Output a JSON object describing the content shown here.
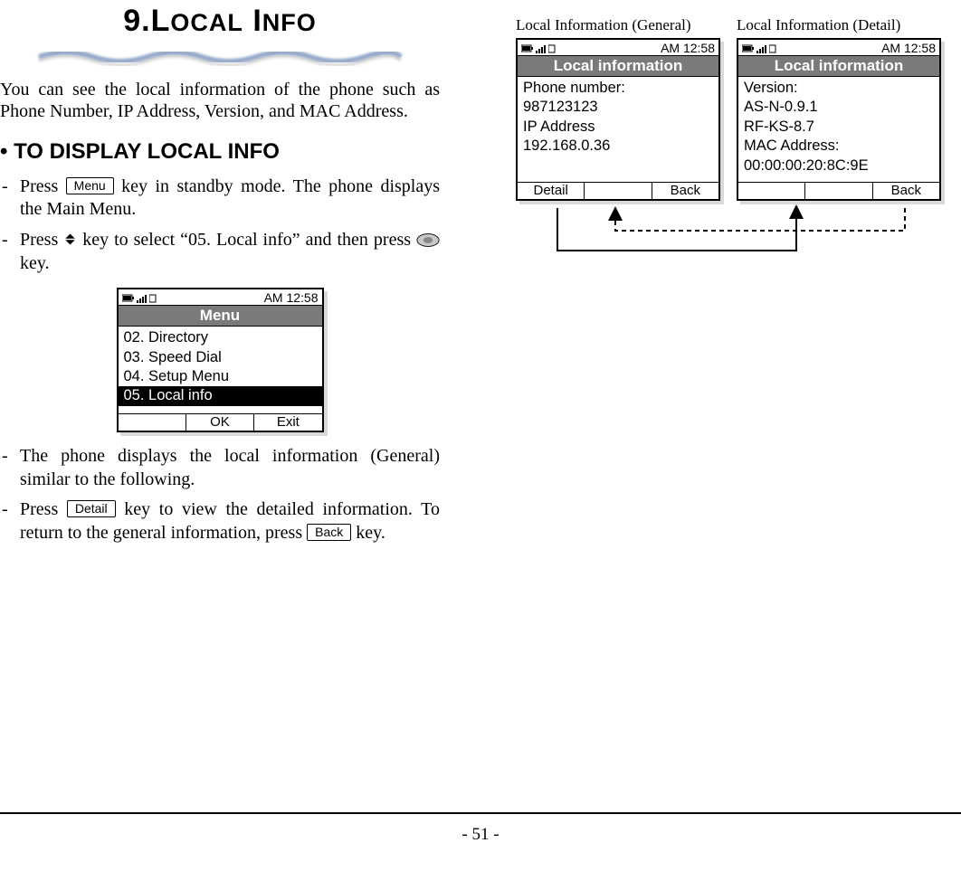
{
  "chapter": {
    "number": "9.",
    "title_word1": "L",
    "title_rest1": "OCAL",
    "title_word2": "I",
    "title_rest2": "NFO"
  },
  "intro": "You can see the local information of the phone such as Phone Number, IP Address, Version, and MAC Address.",
  "section_heading": "• TO DISPLAY LOCAL INFO",
  "steps": {
    "s1a": "Press ",
    "s1b": " key in standby mode. The phone displays the Main Menu.",
    "s2a": "Press ",
    "s2b": " key to select “05. Local info” and then press ",
    "s2c": " key.",
    "s3": "The phone displays the local information (General) similar to the following.",
    "s4a": "Press ",
    "s4b": " key to view the detailed information. To return to the general information, press ",
    "s4c": " key."
  },
  "buttons": {
    "menu": "Menu",
    "detail": "Detail",
    "back": "Back"
  },
  "menu_phone": {
    "time": "AM 12:58",
    "title": "Menu",
    "items": [
      "02. Directory",
      "03. Speed Dial",
      "04. Setup Menu",
      "05. Local info"
    ],
    "selected_index": 3,
    "soft": {
      "left": "",
      "center": "OK",
      "right": "Exit"
    }
  },
  "captions": {
    "general": "Local Information (General)",
    "detail": "Local Information (Detail)"
  },
  "general_phone": {
    "time": "AM 12:58",
    "title": "Local information",
    "lines": [
      "Phone number:",
      "987123123",
      "IP Address",
      "192.168.0.36"
    ],
    "soft": {
      "left": "Detail",
      "center": "",
      "right": "Back"
    }
  },
  "detail_phone": {
    "time": "AM 12:58",
    "title": "Local information",
    "lines": [
      "Version:",
      "AS-N-0.9.1",
      "RF-KS-8.7",
      "MAC Address:",
      "00:00:00:20:8C:9E"
    ],
    "soft": {
      "left": "",
      "center": "",
      "right": "Back"
    }
  },
  "footer": "- 51 -"
}
